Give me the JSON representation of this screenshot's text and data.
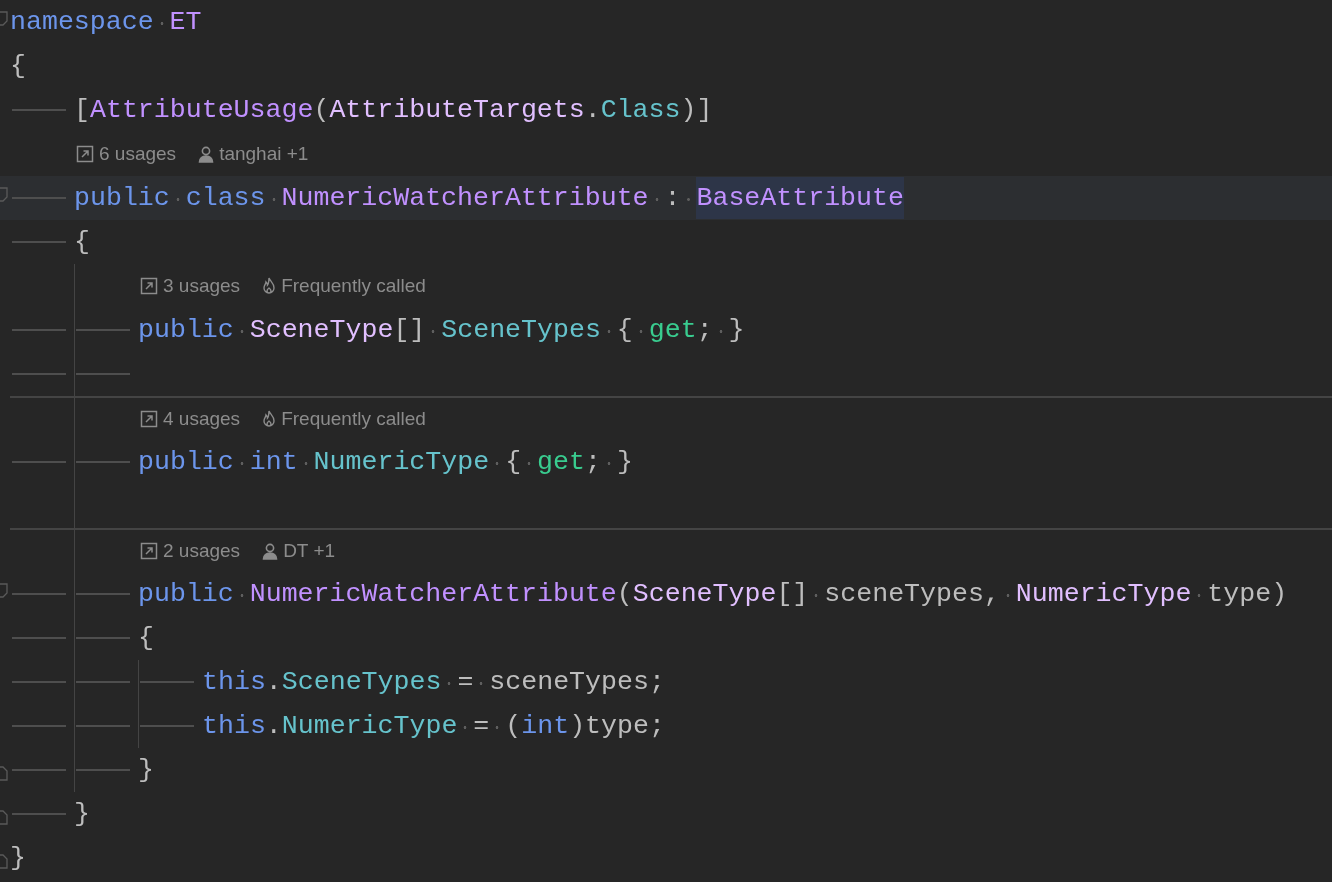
{
  "lines": [
    {
      "kind": "code",
      "fold_start": true,
      "tokens": [
        {
          "t": "namespace ",
          "kind": "keyword"
        },
        {
          "t": "ET",
          "kind": "type"
        }
      ]
    },
    {
      "kind": "code",
      "tokens": [
        {
          "t": "{",
          "kind": "plain"
        }
      ]
    },
    {
      "kind": "code",
      "tabs": [
        {
          "kind": "marker"
        }
      ],
      "tokens": [
        {
          "t": "[",
          "kind": "plain"
        },
        {
          "t": "AttributeUsage",
          "kind": "type"
        },
        {
          "t": "(",
          "kind": "plain"
        },
        {
          "t": "AttributeTargets",
          "kind": "struct"
        },
        {
          "t": ".",
          "kind": "plain"
        },
        {
          "t": "Class",
          "kind": "member"
        },
        {
          "t": ")]",
          "kind": "plain"
        }
      ]
    },
    {
      "kind": "hint",
      "tabs": [
        {
          "kind": "blank"
        }
      ],
      "items": [
        {
          "kind": "usages",
          "text": "6 usages"
        },
        {
          "kind": "author",
          "text": "tanghai +1"
        }
      ]
    },
    {
      "kind": "code",
      "current": true,
      "fold_start": true,
      "tabs": [
        {
          "kind": "marker"
        }
      ],
      "tokens": [
        {
          "t": "public class ",
          "kind": "keyword"
        },
        {
          "t": "NumericWatcherAttribute",
          "kind": "type"
        },
        {
          "t": " : ",
          "kind": "plain"
        },
        {
          "t": "BaseAttribute",
          "kind": "type",
          "highlight": true
        }
      ]
    },
    {
      "kind": "code",
      "tabs": [
        {
          "kind": "marker"
        }
      ],
      "tokens": [
        {
          "t": "{",
          "kind": "plain"
        }
      ]
    },
    {
      "kind": "hint",
      "tabs": [
        {
          "kind": "blank"
        },
        {
          "kind": "guide"
        }
      ],
      "items": [
        {
          "kind": "usages",
          "text": "3 usages"
        },
        {
          "kind": "hot",
          "text": "Frequently called"
        }
      ]
    },
    {
      "kind": "code",
      "tabs": [
        {
          "kind": "marker"
        },
        {
          "kind": "marker_guide"
        }
      ],
      "tokens": [
        {
          "t": "public ",
          "kind": "keyword"
        },
        {
          "t": "SceneType",
          "kind": "struct"
        },
        {
          "t": "[] ",
          "kind": "plain"
        },
        {
          "t": "SceneTypes",
          "kind": "member"
        },
        {
          "t": " { ",
          "kind": "plain"
        },
        {
          "t": "get",
          "kind": "accessor"
        },
        {
          "t": "; }",
          "kind": "plain"
        }
      ]
    },
    {
      "kind": "code",
      "tabs": [
        {
          "kind": "marker"
        },
        {
          "kind": "marker_guide"
        }
      ]
    },
    {
      "kind": "hint",
      "separator_above": true,
      "tabs": [
        {
          "kind": "blank"
        },
        {
          "kind": "guide"
        }
      ],
      "items": [
        {
          "kind": "usages",
          "text": "4 usages"
        },
        {
          "kind": "hot",
          "text": "Frequently called"
        }
      ]
    },
    {
      "kind": "code",
      "tabs": [
        {
          "kind": "marker"
        },
        {
          "kind": "marker_guide"
        }
      ],
      "tokens": [
        {
          "t": "public int ",
          "kind": "keyword"
        },
        {
          "t": "NumericType",
          "kind": "member"
        },
        {
          "t": " { ",
          "kind": "plain"
        },
        {
          "t": "get",
          "kind": "accessor"
        },
        {
          "t": "; }",
          "kind": "plain"
        }
      ]
    },
    {
      "kind": "code",
      "tabs": [
        {
          "kind": "blank"
        },
        {
          "kind": "guide"
        }
      ]
    },
    {
      "kind": "hint",
      "separator_above": true,
      "tabs": [
        {
          "kind": "blank"
        },
        {
          "kind": "guide"
        }
      ],
      "items": [
        {
          "kind": "usages",
          "text": "2 usages"
        },
        {
          "kind": "author",
          "text": "DT +1"
        }
      ]
    },
    {
      "kind": "code",
      "fold_start": true,
      "tabs": [
        {
          "kind": "marker"
        },
        {
          "kind": "marker_guide"
        }
      ],
      "tokens": [
        {
          "t": "public ",
          "kind": "keyword"
        },
        {
          "t": "NumericWatcherAttribute",
          "kind": "type"
        },
        {
          "t": "(",
          "kind": "plain"
        },
        {
          "t": "SceneType",
          "kind": "struct"
        },
        {
          "t": "[] sceneTypes, ",
          "kind": "plain"
        },
        {
          "t": "NumericType",
          "kind": "struct"
        },
        {
          "t": " type)",
          "kind": "plain"
        }
      ]
    },
    {
      "kind": "code",
      "tabs": [
        {
          "kind": "marker"
        },
        {
          "kind": "marker_guide"
        }
      ],
      "tokens": [
        {
          "t": "{",
          "kind": "plain"
        }
      ]
    },
    {
      "kind": "code",
      "tabs": [
        {
          "kind": "marker"
        },
        {
          "kind": "marker_guide"
        },
        {
          "kind": "marker_guide"
        }
      ],
      "tokens": [
        {
          "t": "this",
          "kind": "keyword"
        },
        {
          "t": ".",
          "kind": "plain"
        },
        {
          "t": "SceneTypes",
          "kind": "member"
        },
        {
          "t": " = sceneTypes;",
          "kind": "plain"
        }
      ]
    },
    {
      "kind": "code",
      "tabs": [
        {
          "kind": "marker"
        },
        {
          "kind": "marker_guide"
        },
        {
          "kind": "marker_guide"
        }
      ],
      "tokens": [
        {
          "t": "this",
          "kind": "keyword"
        },
        {
          "t": ".",
          "kind": "plain"
        },
        {
          "t": "NumericType",
          "kind": "member"
        },
        {
          "t": " = (",
          "kind": "plain"
        },
        {
          "t": "int",
          "kind": "keyword"
        },
        {
          "t": ")type;",
          "kind": "plain"
        }
      ]
    },
    {
      "kind": "code",
      "fold_end": true,
      "tabs": [
        {
          "kind": "marker"
        },
        {
          "kind": "marker_guide"
        }
      ],
      "tokens": [
        {
          "t": "}",
          "kind": "plain"
        }
      ]
    },
    {
      "kind": "code",
      "fold_end": true,
      "tabs": [
        {
          "kind": "marker"
        }
      ],
      "tokens": [
        {
          "t": "}",
          "kind": "plain"
        }
      ]
    },
    {
      "kind": "code",
      "fold_end": true,
      "tokens": [
        {
          "t": "}",
          "kind": "plain"
        }
      ]
    }
  ]
}
